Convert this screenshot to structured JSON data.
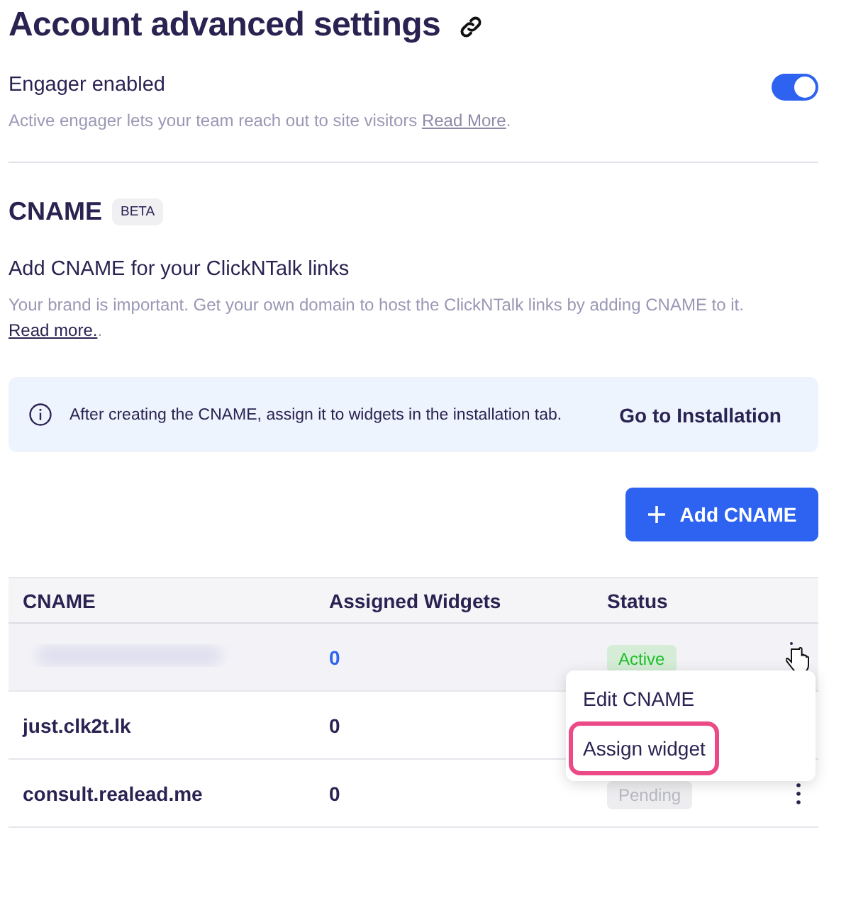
{
  "page": {
    "title": "Account advanced settings"
  },
  "engager": {
    "label": "Engager enabled",
    "on": true,
    "description": "Active engager lets your team reach out to site visitors",
    "link": "Read More",
    "suffix": "."
  },
  "cname": {
    "title": "CNAME",
    "badge": "BETA",
    "subtitle": "Add CNAME for your ClickNTalk links",
    "description": "Your brand is important. Get your own domain to host the ClickNTalk links by adding CNAME to it.",
    "link": "Read more.",
    "suffix": "."
  },
  "notice": {
    "text": "After creating the CNAME, assign it to widgets in the installation tab.",
    "action": "Go to Installation"
  },
  "add_button": {
    "label": "Add CNAME"
  },
  "table": {
    "columns": [
      "CNAME",
      "Assigned Widgets",
      "Status"
    ],
    "rows": [
      {
        "kind": "blurred",
        "widgets": "0",
        "widgets_link": true,
        "status": {
          "label": "Active",
          "kind": "active"
        },
        "hovered": true,
        "kebab_visible": false
      },
      {
        "kind": "text",
        "name": "just.clk2t.lk",
        "widgets": "0",
        "widgets_link": false,
        "hovered": false,
        "kebab_visible": false
      },
      {
        "kind": "text",
        "name": "consult.realead.me",
        "widgets": "0",
        "widgets_link": false,
        "status": {
          "label": "Pending",
          "kind": "pending"
        },
        "hovered": false,
        "kebab_visible": true
      }
    ]
  },
  "menu": {
    "items": [
      {
        "label": "Edit CNAME",
        "highlighted": false
      },
      {
        "label": "Assign widget",
        "highlighted": true
      }
    ]
  }
}
